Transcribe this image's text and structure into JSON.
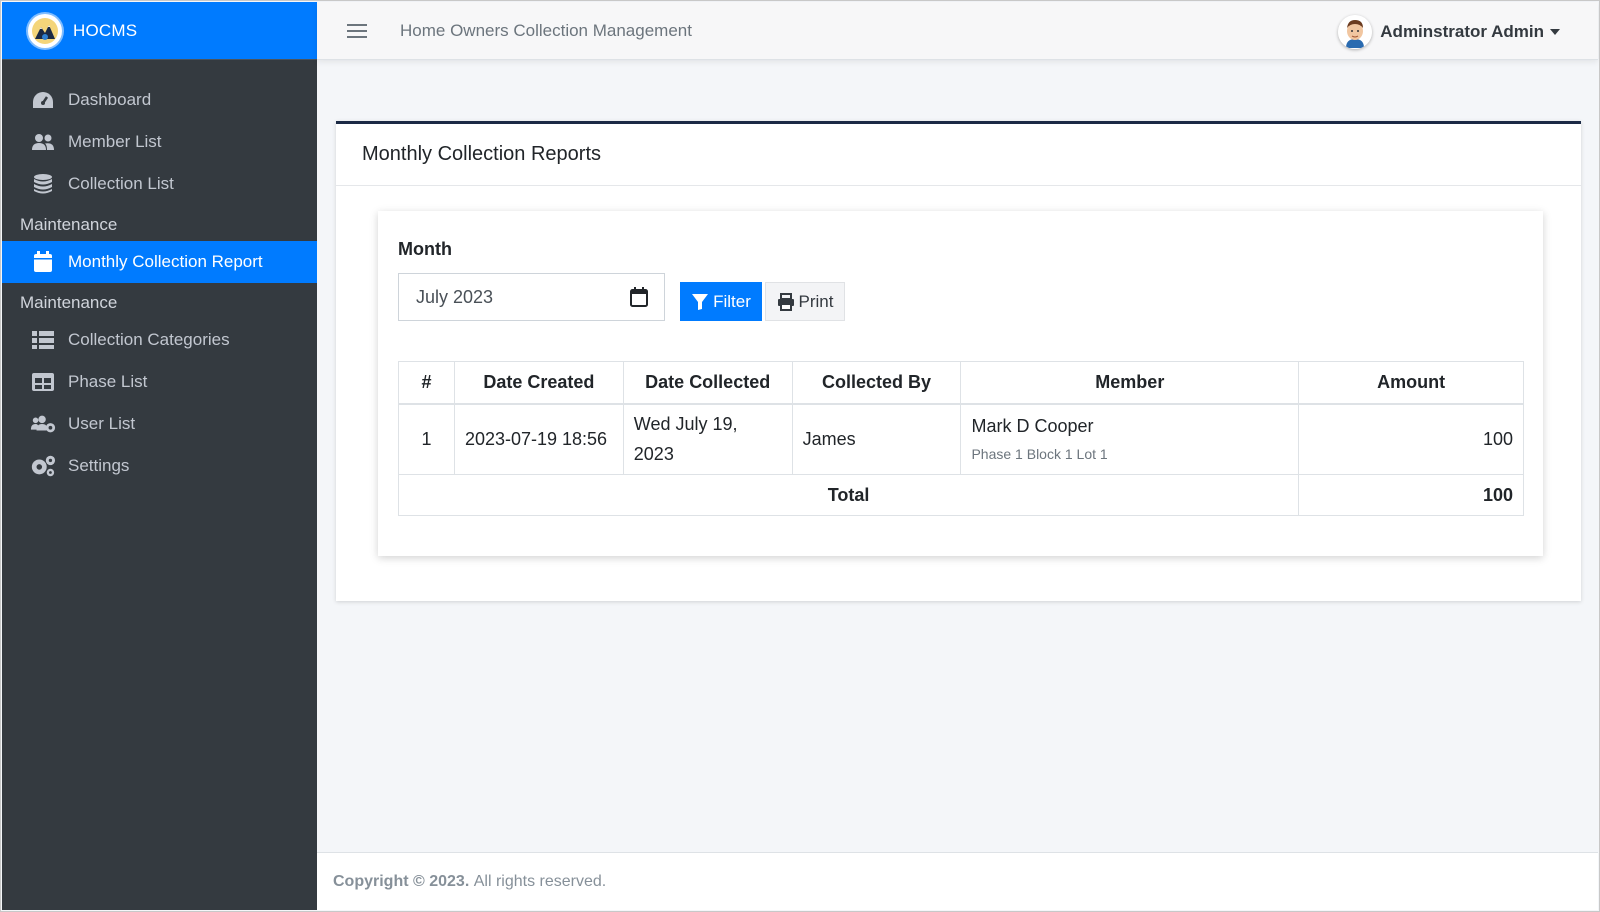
{
  "brand": {
    "name": "HOCMS",
    "accent": "#007bff"
  },
  "sidebar": {
    "items": [
      {
        "label": "Dashboard",
        "icon": "tachometer-icon"
      },
      {
        "label": "Member List",
        "icon": "users-icon"
      },
      {
        "label": "Collection List",
        "icon": "coins-icon"
      }
    ],
    "section1": {
      "header": "Maintenance",
      "items": [
        {
          "label": "Monthly Collection Report",
          "icon": "calendar-icon",
          "active": true
        }
      ]
    },
    "section2": {
      "header": "Maintenance",
      "items": [
        {
          "label": "Collection Categories",
          "icon": "list-icon"
        },
        {
          "label": "Phase List",
          "icon": "table-icon"
        },
        {
          "label": "User List",
          "icon": "users-cog-icon"
        },
        {
          "label": "Settings",
          "icon": "cogs-icon"
        }
      ]
    }
  },
  "topbar": {
    "title": "Home Owners Collection Management",
    "user": "Adminstrator Admin"
  },
  "card": {
    "title": "Monthly Collection Reports"
  },
  "filter": {
    "month_label": "Month",
    "month_value": "July 2023",
    "filter_label": "Filter",
    "print_label": "Print"
  },
  "table": {
    "headers": [
      "#",
      "Date Created",
      "Date Collected",
      "Collected By",
      "Member",
      "Amount"
    ],
    "rows": [
      {
        "num": "1",
        "date_created": "2023-07-19 18:56",
        "date_collected_line1": "Wed July 19,",
        "date_collected_line2": "2023",
        "collected_by": "James",
        "member_name": "Mark D Cooper",
        "member_location": "Phase 1 Block 1 Lot 1",
        "amount": "100"
      }
    ],
    "total_label": "Total",
    "total_amount": "100"
  },
  "footer": {
    "copyright": "Copyright © 2023.",
    "rights": "All rights reserved."
  }
}
